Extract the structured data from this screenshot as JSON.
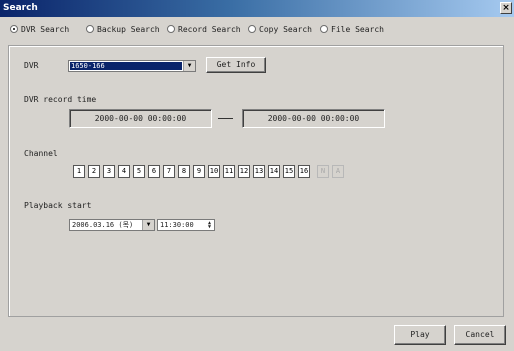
{
  "window": {
    "title": "Search",
    "close_symbol": "×"
  },
  "tabs": [
    {
      "label": "DVR Search",
      "selected": true
    },
    {
      "label": "Backup Search",
      "selected": false
    },
    {
      "label": "Record Search",
      "selected": false
    },
    {
      "label": "Copy Search",
      "selected": false
    },
    {
      "label": "File Search",
      "selected": false
    }
  ],
  "dvr": {
    "label": "DVR",
    "selected_value": "1650-166",
    "get_info_label": "Get Info"
  },
  "record_time": {
    "label": "DVR record time",
    "start": "2000-00-00 00:00:00",
    "separator": "—",
    "end": "2000-00-00 00:00:00"
  },
  "channel": {
    "label": "Channel",
    "items": [
      "1",
      "2",
      "3",
      "4",
      "5",
      "6",
      "7",
      "8",
      "9",
      "10",
      "11",
      "12",
      "13",
      "14",
      "15",
      "16"
    ],
    "extra_buttons": [
      "N",
      "A"
    ]
  },
  "playback": {
    "label": "Playback start",
    "date": "2006.03.16 (목)",
    "time": "11:30:00"
  },
  "footer": {
    "play_label": "Play",
    "cancel_label": "Cancel"
  }
}
